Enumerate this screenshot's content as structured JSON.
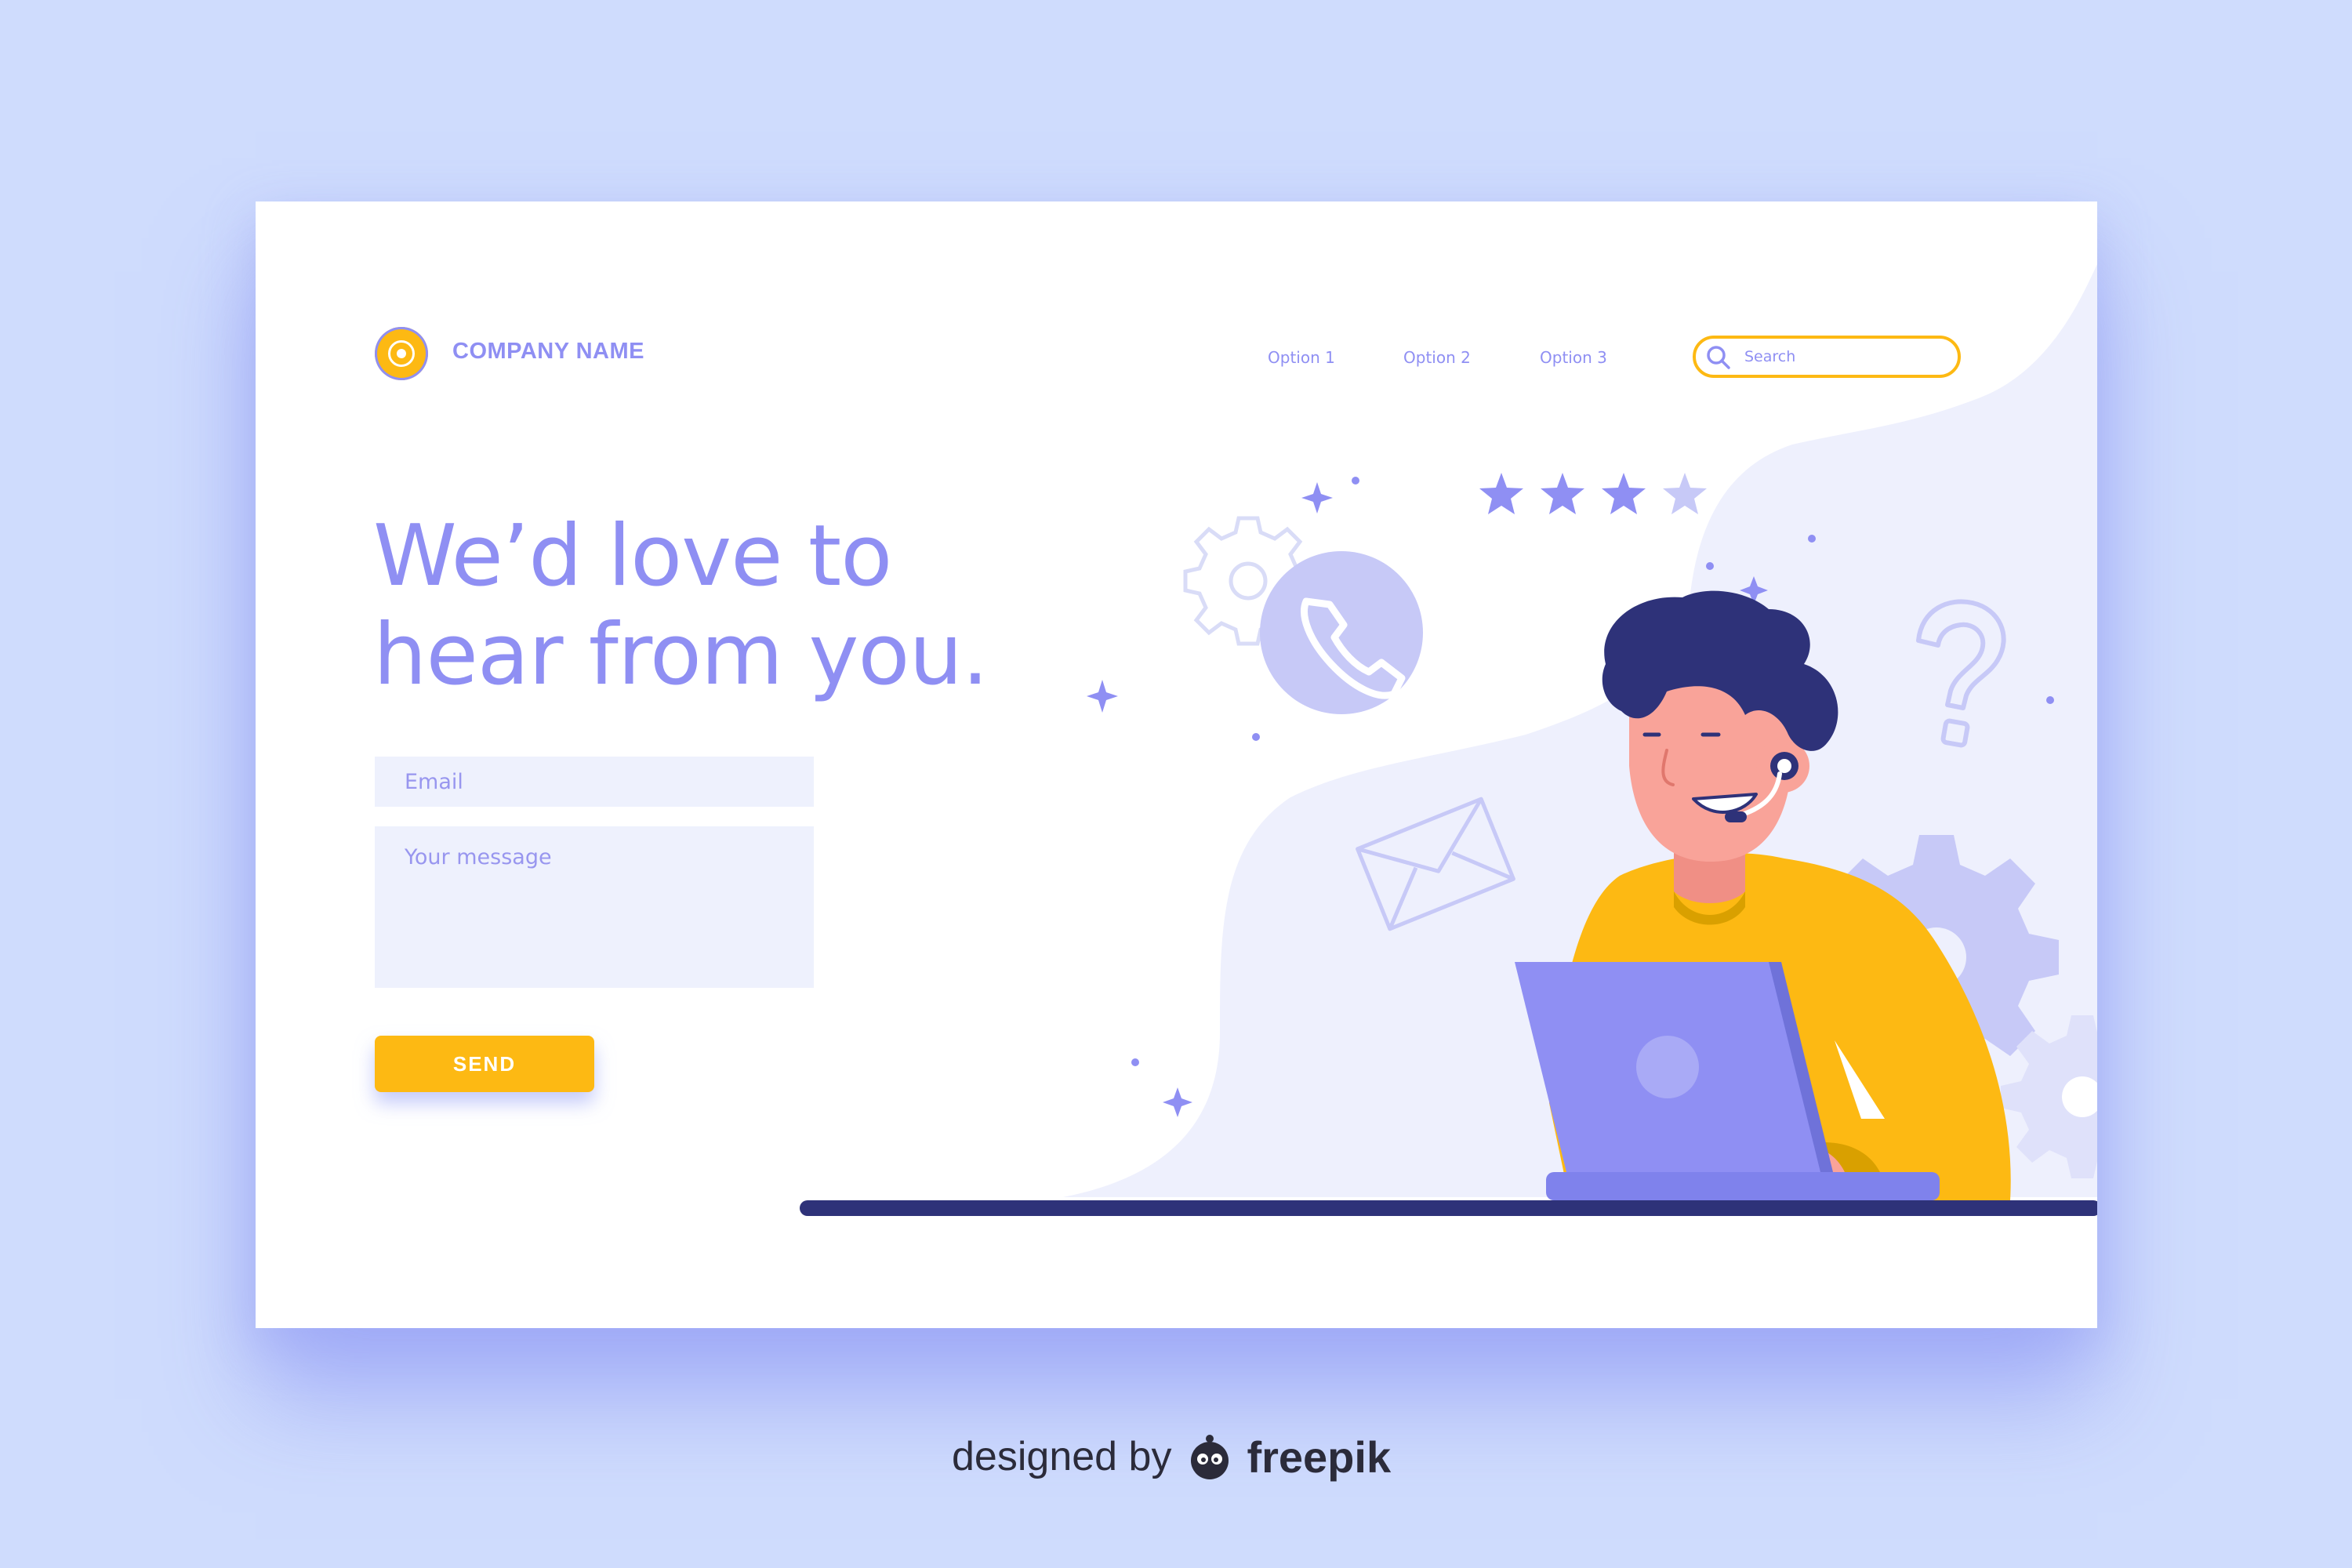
{
  "brand": {
    "company_name": "COMPANY NAME",
    "logo_icon": "target-circle"
  },
  "nav": {
    "items": [
      {
        "label": "Option 1"
      },
      {
        "label": "Option 2"
      },
      {
        "label": "Option 3"
      }
    ],
    "search": {
      "placeholder": "Search",
      "icon": "search-icon"
    }
  },
  "hero": {
    "headline_line1": "We’d love to",
    "headline_line2": "hear from you."
  },
  "form": {
    "email_placeholder": "Email",
    "message_placeholder": "Your message",
    "send_label": "SEND"
  },
  "illustration": {
    "rating_stars_filled": 3,
    "rating_stars_total": 4,
    "icons": [
      "phone-icon",
      "gear-icon",
      "envelope-icon",
      "question-mark-icon",
      "sparkle-icon"
    ]
  },
  "credit": {
    "prefix": "designed by",
    "brand": "freepik"
  },
  "colors": {
    "background": "#cfdcfd",
    "accent_purple": "#8f8ff3",
    "accent_yellow": "#fdb913",
    "navy": "#2e3279",
    "field_bg": "#eef1fd"
  }
}
